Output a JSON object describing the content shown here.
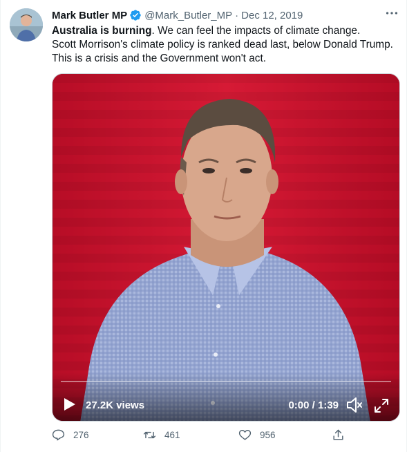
{
  "author": {
    "name": "Mark Butler MP",
    "handle": "@Mark_Butler_MP",
    "separator": "·",
    "date": "Dec 12, 2019"
  },
  "tweet": {
    "bold_lead": "Australia is burning",
    "line1_rest": ". We can feel the impacts of climate change.",
    "line2": "Scott Morrison's climate policy is ranked dead last, below Donald Trump.",
    "line3": "This is a crisis and the Government won't act."
  },
  "video": {
    "views": "27.2K views",
    "time": "0:00 / 1:39",
    "progress": 0
  },
  "actions": {
    "replies": "276",
    "retweets": "461",
    "likes": "956"
  },
  "icons": {
    "verified": "verified-badge-icon",
    "more": "more-dots-icon",
    "play": "play-icon",
    "volume": "volume-muted-icon",
    "fullscreen": "fullscreen-icon",
    "reply": "reply-icon",
    "retweet": "retweet-icon",
    "like": "heart-icon",
    "share": "share-icon"
  },
  "colors": {
    "verified_blue": "#1d9bf0",
    "muted_text": "#536471",
    "video_background": "#c8102b"
  }
}
